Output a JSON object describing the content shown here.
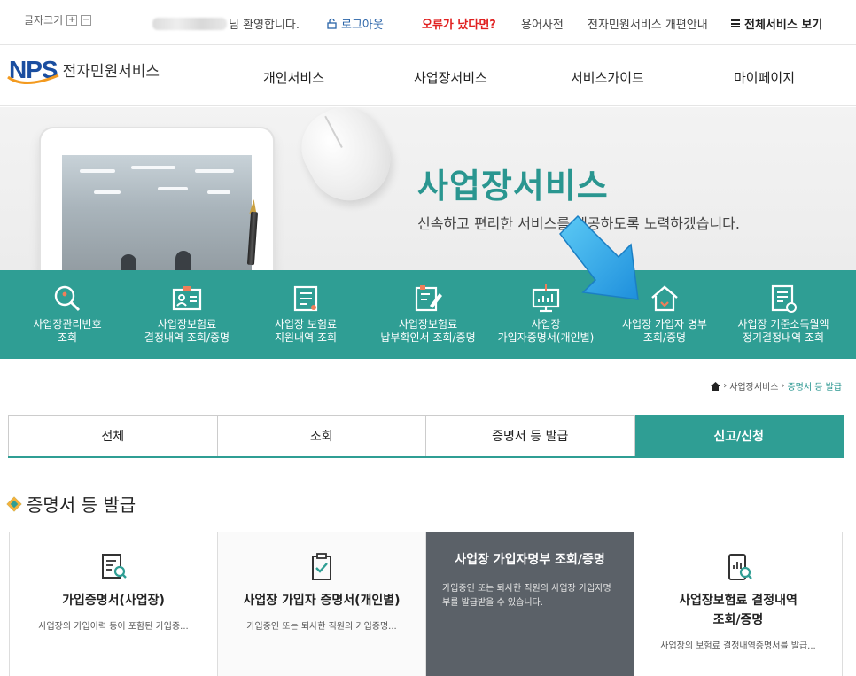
{
  "topbar": {
    "font_size_label": "글자크기",
    "font_plus": "+",
    "font_minus": "−",
    "welcome_suffix": "님 환영합니다.",
    "logout": "로그아웃",
    "error_report": "오류가 났다면?",
    "glossary": "용어사전",
    "renewal_notice": "전자민원서비스 개편안내",
    "all_services": "전체서비스 보기"
  },
  "logo": {
    "brand": "NPS",
    "service_name": "전자민원서비스"
  },
  "gnb": [
    "개인서비스",
    "사업장서비스",
    "서비스가이드",
    "마이페이지"
  ],
  "hero": {
    "title": "사업장서비스",
    "subtitle": "신속하고 편리한 서비스를 제공하도록 노력하겠습니다."
  },
  "quick_menu": [
    {
      "line1": "사업장관리번호",
      "line2": "조회",
      "icon": "search-icon"
    },
    {
      "line1": "사업장보험료",
      "line2": "결정내역 조회/증명",
      "icon": "id-card-icon"
    },
    {
      "line1": "사업장 보험료",
      "line2": "지원내역 조회",
      "icon": "document-list-icon"
    },
    {
      "line1": "사업장보험료",
      "line2": "납부확인서 조회/증명",
      "icon": "edit-document-icon"
    },
    {
      "line1": "사업장",
      "line2": "가입자증명서(개인별)",
      "icon": "monitor-chart-icon"
    },
    {
      "line1": "사업장 가입자 명부",
      "line2": "조회/증명",
      "icon": "house-icon"
    },
    {
      "line1": "사업장 기준소득월액",
      "line2": "정기결정내역 조회",
      "icon": "report-icon"
    }
  ],
  "breadcrumb": {
    "parent": "사업장서비스",
    "current": "증명서 등 발급"
  },
  "tabs": [
    {
      "label": "전체",
      "active": false
    },
    {
      "label": "조회",
      "active": false
    },
    {
      "label": "증명서 등 발급",
      "active": false
    },
    {
      "label": "신고/신청",
      "active": true
    }
  ],
  "section": {
    "title": "증명서 등 발급"
  },
  "cards": [
    {
      "title": "가입증명서(사업장)",
      "desc": "사업장의 가입이력 등이 포함된 가입증...",
      "icon": "document-search-icon"
    },
    {
      "title": "사업장 가입자 증명서(개인별)",
      "desc": "가입중인 또는 퇴사한 직원의 가입증명...",
      "icon": "clipboard-check-icon"
    },
    {
      "title": "사업장 가입자명부 조회/증명",
      "desc": "가입중인 또는 퇴사한 직원의 사업장 가입자명부를 발급받을 수 있습니다.",
      "icon": ""
    },
    {
      "title_line1": "사업장보험료 결정내역",
      "title_line2": "조회/증명",
      "desc": "사업장의 보험료 결정내역증명서를 발급...",
      "icon": "tablet-chart-search-icon"
    }
  ],
  "colors": {
    "primary": "#2f9e94",
    "brand_blue": "#1a4ea0",
    "error_red": "#e02020",
    "card_dark": "#5b6168"
  }
}
